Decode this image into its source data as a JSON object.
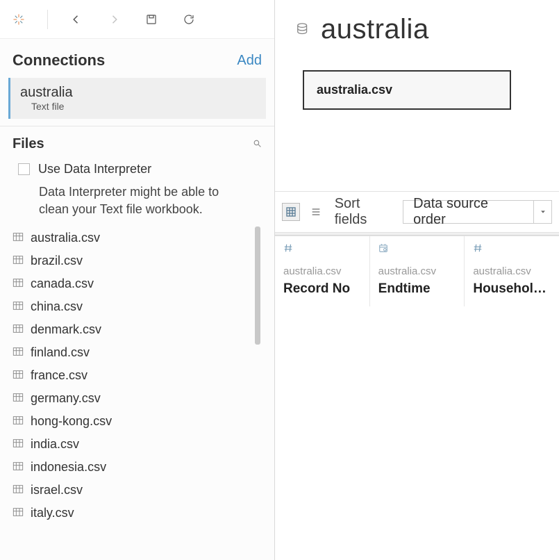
{
  "toolbar": {
    "back_icon": "arrow-left",
    "forward_icon": "arrow-right",
    "save_icon": "save",
    "refresh_icon": "refresh"
  },
  "connections": {
    "header": "Connections",
    "add_label": "Add",
    "items": [
      {
        "name": "australia",
        "type": "Text file"
      }
    ]
  },
  "files": {
    "header": "Files",
    "interpreter_label": "Use Data Interpreter",
    "interpreter_hint": "Data Interpreter might be able to clean your Text file workbook.",
    "items": [
      "australia.csv",
      "brazil.csv",
      "canada.csv",
      "china.csv",
      "denmark.csv",
      "finland.csv",
      "france.csv",
      "germany.csv",
      "hong-kong.csv",
      "india.csv",
      "indonesia.csv",
      "israel.csv",
      "italy.csv"
    ]
  },
  "datasource": {
    "title": "australia",
    "node_label": "australia.csv"
  },
  "grid": {
    "sort_label": "Sort fields",
    "sort_value": "Data source order",
    "columns": [
      {
        "type": "number",
        "source": "australia.csv",
        "name": "Record No"
      },
      {
        "type": "datetime",
        "source": "australia.csv",
        "name": "Endtime"
      },
      {
        "type": "number",
        "source": "australia.csv",
        "name": "Household ..."
      }
    ]
  }
}
